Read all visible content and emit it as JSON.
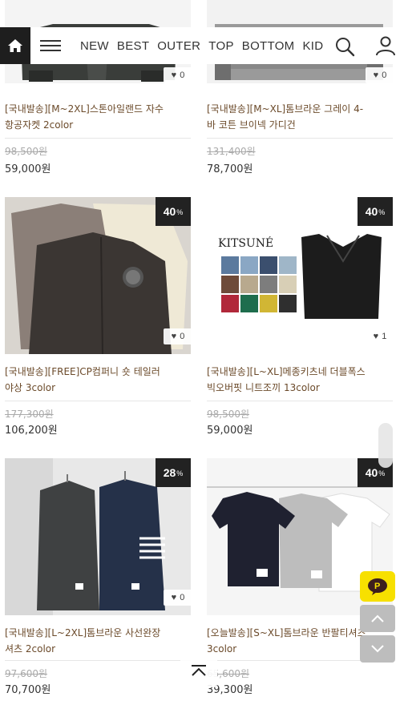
{
  "nav": {
    "items": [
      "NEW",
      "BEST",
      "OUTER",
      "TOP",
      "BOTTOM",
      "KID"
    ],
    "icons": {
      "home": "home-icon",
      "menu": "hamburger-menu-icon",
      "search": "search-icon",
      "user": "user-icon"
    }
  },
  "products": [
    {
      "name_line1": "[국내발송][M~2XL]스톤아일랜드 자수",
      "name_line2": "항공자켓 2color",
      "original_price": "98,500원",
      "price": "59,000원",
      "likes": "0",
      "discount": ""
    },
    {
      "name_line1": "[국내발송][M~XL]톰브라운 그레이 4-",
      "name_line2": "바 코튼 브이넥 가디건",
      "original_price": "131,400원",
      "price": "78,700원",
      "likes": "0",
      "discount": ""
    },
    {
      "name_line1": "[국내발송][FREE]CP컴퍼니 숏 테일러",
      "name_line2": "야상 3color",
      "original_price": "177,300원",
      "price": "106,200원",
      "likes": "0",
      "discount": "40",
      "discount_unit": "%"
    },
    {
      "name_line1": "[국내발송][L~XL]메종키츠네 더블폭스",
      "name_line2": "빅오버핏 니트조끼 13color",
      "original_price": "98,500원",
      "price": "59,000원",
      "likes": "1",
      "discount": "40",
      "discount_unit": "%",
      "brand_text": "KITSUNÉ"
    },
    {
      "name_line1": "[국내발송][L~2XL]톰브라운 사선완장",
      "name_line2": "셔츠 2color",
      "original_price": "97,600원",
      "price": "70,700원",
      "likes": "0",
      "discount": "28",
      "discount_unit": "%"
    },
    {
      "name_line1": "[오늘발송][S~XL]톰브라운 반팔티셔츠",
      "name_line2": "3color",
      "original_price": "65,600원",
      "price": "39,300원",
      "likes": "",
      "discount": "40",
      "discount_unit": "%"
    }
  ],
  "colors": {
    "accent_dark": "#1e1e1e",
    "name_text": "#6b4a2a",
    "kakao": "#f7e000"
  }
}
